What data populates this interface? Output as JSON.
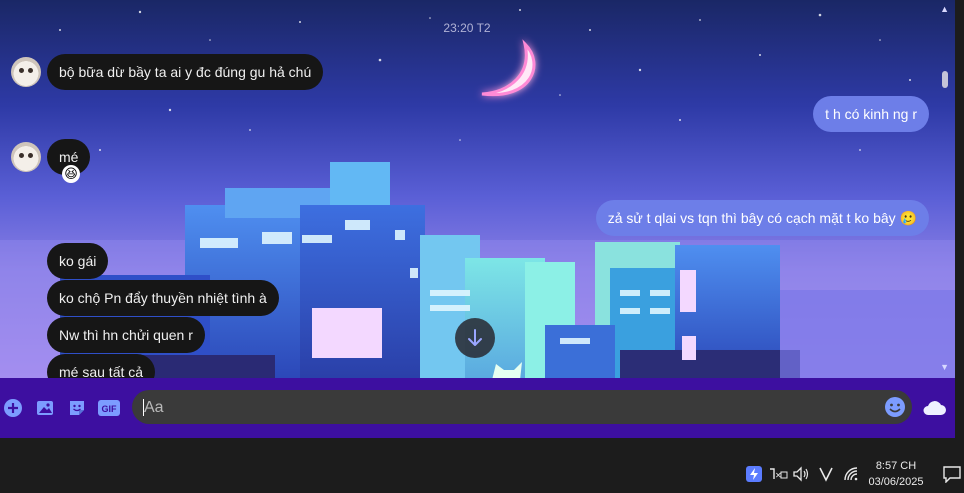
{
  "chat": {
    "timestamp": "23:20 T2",
    "messages": [
      {
        "side": "in",
        "text": "bộ bữa dừ bầy ta ai y đc đúng gu hả chú"
      },
      {
        "side": "out",
        "text": "t h có kinh ng r"
      },
      {
        "side": "in",
        "text": "mé",
        "reaction": "😆"
      },
      {
        "side": "out",
        "text": "zả sử t qlai vs tqn thì bây có cạch mặt t ko bây 🥲"
      },
      {
        "side": "in",
        "text": "ko gái"
      },
      {
        "side": "in",
        "text": "ko chộ Pn đẩy thuyền nhiệt tình à"
      },
      {
        "side": "in",
        "text": "Nw thì hn chửi quen r"
      },
      {
        "side": "in",
        "text": "mé sau tất cả"
      }
    ]
  },
  "composer": {
    "placeholder": "Aa",
    "tools": [
      "add-icon",
      "image-icon",
      "sticker-icon",
      "gif-icon"
    ],
    "gif_label": "GIF",
    "right_icons": [
      "emoji-icon",
      "cloud-icon"
    ]
  },
  "taskbar": {
    "time": "8:57 CH",
    "date": "03/06/2025",
    "tray": [
      "app-icon",
      "keyboard-icon",
      "volume-icon",
      "v-icon",
      "wifi-icon",
      "notification-icon"
    ]
  },
  "colors": {
    "incoming_bubble": "#161616",
    "outgoing_bubble": "#6d7ee8",
    "composer_bg": "#3d0fa0",
    "taskbar_bg": "#1c1c1c"
  }
}
